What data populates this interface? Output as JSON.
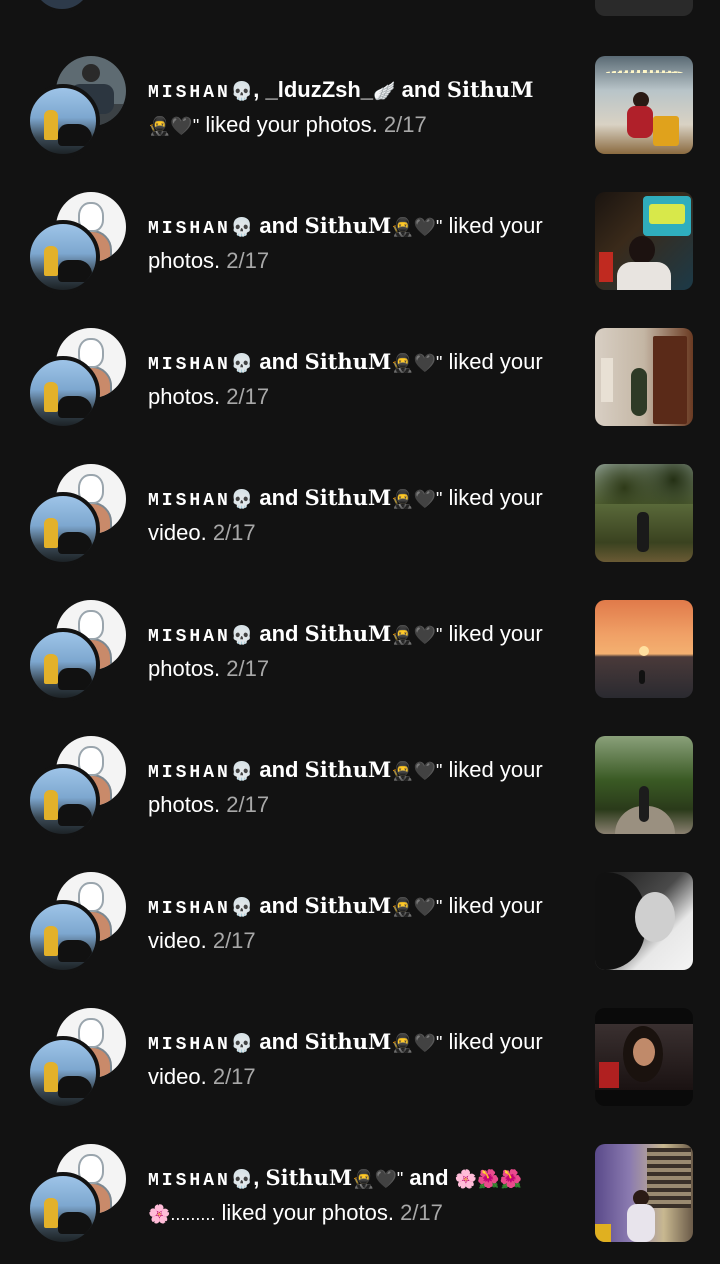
{
  "notifications": [
    {
      "user1": "MISHAN",
      "user1_emoji": "💀",
      "sep1": ", ",
      "user2": "_lduzZsh_",
      "user2_emoji": "🪽",
      "sep2": " and ",
      "user3": "SithuM",
      "line2_prefix": "🥷🖤\"",
      "action": " liked your photos.",
      "date": " 2/17",
      "avatar_top": "photo"
    },
    {
      "user1": "MISHAN",
      "user1_emoji": "💀",
      "sep1": " and ",
      "user2": "SithuM",
      "user2_emoji": "🥷🖤\"",
      "action": " liked your photos.",
      "date": " 2/17",
      "avatar_top": "sketch"
    },
    {
      "user1": "MISHAN",
      "user1_emoji": "💀",
      "sep1": " and ",
      "user2": "SithuM",
      "user2_emoji": "🥷🖤\"",
      "action": " liked your photos.",
      "date": " 2/17",
      "avatar_top": "sketch"
    },
    {
      "user1": "MISHAN",
      "user1_emoji": "💀",
      "sep1": " and ",
      "user2": "SithuM",
      "user2_emoji": "🥷🖤\"",
      "action": " liked your video.",
      "date": " 2/17",
      "avatar_top": "sketch"
    },
    {
      "user1": "MISHAN",
      "user1_emoji": "💀",
      "sep1": " and ",
      "user2": "SithuM",
      "user2_emoji": "🥷🖤\"",
      "action": " liked your photos.",
      "date": " 2/17",
      "avatar_top": "sketch"
    },
    {
      "user1": "MISHAN",
      "user1_emoji": "💀",
      "sep1": " and ",
      "user2": "SithuM",
      "user2_emoji": "🥷🖤\"",
      "action": " liked your photos.",
      "date": " 2/17",
      "avatar_top": "sketch"
    },
    {
      "user1": "MISHAN",
      "user1_emoji": "💀",
      "sep1": " and ",
      "user2": "SithuM",
      "user2_emoji": "🥷🖤\"",
      "action": " liked your video.",
      "date": " 2/17",
      "avatar_top": "sketch"
    },
    {
      "user1": "MISHAN",
      "user1_emoji": "💀",
      "sep1": " and ",
      "user2": "SithuM",
      "user2_emoji": "🥷🖤\"",
      "action": " liked your video.",
      "date": " 2/17",
      "avatar_top": "sketch"
    },
    {
      "user1": "MISHAN",
      "user1_emoji": "💀",
      "sep1": ", ",
      "user2": "SithuM",
      "user2_emoji": "🥷🖤\"",
      "sep2": " and ",
      "user3": "🌸🌺🌺",
      "line2_prefix": "🌸.........",
      "action": " liked your photos.",
      "date": " 2/17",
      "avatar_top": "sketch"
    }
  ],
  "thumb_icons": [
    "fairy-lights-portrait-thumbnail",
    "neon-sign-selfie-thumbnail",
    "door-room-photo-thumbnail",
    "forest-person-video-thumbnail",
    "sunset-beach-thumbnail",
    "forest-path-thumbnail",
    "black-white-portrait-thumbnail",
    "portrait-selfie-thumbnail",
    "window-portrait-thumbnail"
  ],
  "colors": {
    "background": "#121212",
    "text": "#ffffff",
    "date_text": "#a8a8a8"
  }
}
